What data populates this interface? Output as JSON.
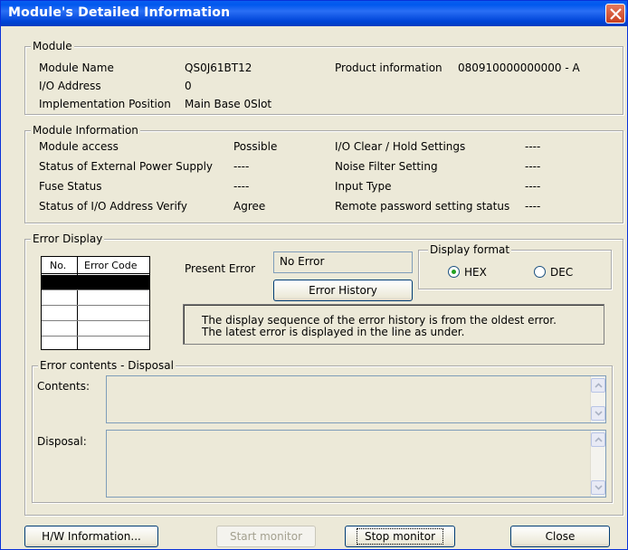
{
  "window": {
    "title": "Module's Detailed Information"
  },
  "module": {
    "legend": "Module",
    "name_label": "Module Name",
    "name_value": "QS0J61BT12",
    "product_label": "Product information",
    "product_value": "080910000000000 - A",
    "io_label": "I/O Address",
    "io_value": "0",
    "impl_label": "Implementation Position",
    "impl_value": "Main Base  0Slot"
  },
  "module_info": {
    "legend": "Module Information",
    "rows_left": [
      {
        "label": "Module access",
        "value": "Possible"
      },
      {
        "label": "Status of External Power Supply",
        "value": "----"
      },
      {
        "label": "Fuse Status",
        "value": "----"
      },
      {
        "label": "Status of I/O Address Verify",
        "value": "Agree"
      }
    ],
    "rows_right": [
      {
        "label": "I/O Clear / Hold Settings",
        "value": "----"
      },
      {
        "label": "Noise Filter Setting",
        "value": "----"
      },
      {
        "label": "Input Type",
        "value": "----"
      },
      {
        "label": "Remote password setting status",
        "value": "----"
      }
    ]
  },
  "error_display": {
    "legend": "Error Display",
    "table_headers": [
      "No.",
      "Error Code"
    ],
    "present_error_label": "Present Error",
    "present_error_value": "No Error",
    "history_button": "Error History",
    "display_format": {
      "legend": "Display format",
      "options": [
        "HEX",
        "DEC"
      ],
      "selected": "HEX"
    },
    "info_lines": [
      "The display sequence of the error history is from the oldest error.",
      "The latest error is displayed in the line as under."
    ],
    "contents_disposal": {
      "legend": "Error contents - Disposal",
      "contents_label": "Contents:",
      "disposal_label": "Disposal:"
    }
  },
  "buttons": {
    "hw_info": "H/W Information...",
    "start_monitor": "Start monitor",
    "stop_monitor": "Stop monitor",
    "close": "Close"
  }
}
